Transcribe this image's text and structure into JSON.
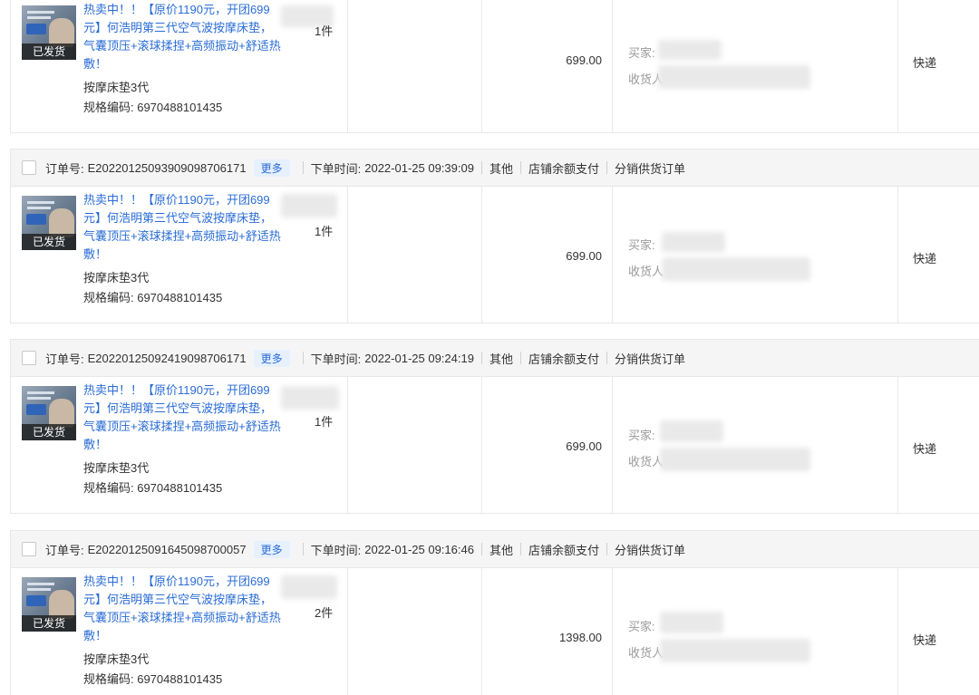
{
  "product": {
    "badge": "已发货",
    "title": "热卖中！！【原价1190元，开团699元】何浩明第三代空气波按摩床垫，气囊顶压+滚球揉捏+高频振动+舒适热敷！",
    "spec": "按摩床垫3代",
    "code": "规格编码: 6970488101435"
  },
  "labels": {
    "order_no": "订单号:",
    "more": "更多",
    "order_time": "下单时间:",
    "other": "其他",
    "payment": "店铺余额支付",
    "order_type": "分销供货订单",
    "buyer": "买家:",
    "receiver": "收货人"
  },
  "orders": [
    {
      "order_no": "",
      "time": "",
      "qty": "1件",
      "amount": "699.00",
      "shipping": "快递"
    },
    {
      "order_no": "E20220125093909098706171",
      "time": "2022-01-25 09:39:09",
      "qty": "1件",
      "amount": "699.00",
      "shipping": "快递"
    },
    {
      "order_no": "E20220125092419098706171",
      "time": "2022-01-25 09:24:19",
      "qty": "1件",
      "amount": "699.00",
      "shipping": "快递"
    },
    {
      "order_no": "E20220125091645098700057",
      "time": "2022-01-25 09:16:46",
      "qty": "2件",
      "amount": "1398.00",
      "shipping": "快递"
    }
  ]
}
